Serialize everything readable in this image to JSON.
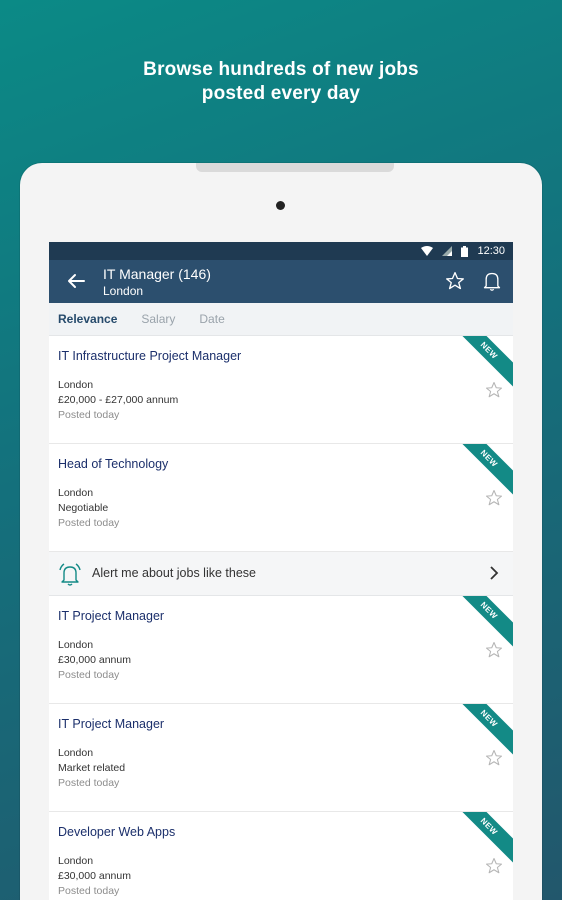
{
  "headline": {
    "line1": "Browse hundreds of new jobs",
    "line2": "posted every day"
  },
  "statusbar": {
    "time": "12:30",
    "icons": [
      "wifi-icon",
      "signal-icon",
      "battery-icon"
    ]
  },
  "appbar": {
    "title": "IT Manager (146)",
    "subtitle": "London",
    "icons": [
      "back-arrow-icon",
      "star-outline-icon",
      "bell-icon"
    ],
    "color": "#2c4f6e"
  },
  "sort": {
    "tabs": [
      {
        "label": "Relevance",
        "active": true
      },
      {
        "label": "Salary",
        "active": false
      },
      {
        "label": "Date",
        "active": false
      }
    ]
  },
  "jobs": [
    {
      "title": "IT Infrastructure Project Manager",
      "location": "London",
      "salary": "£20,000 - £27,000 annum",
      "posted": "Posted today",
      "badge": "NEW"
    },
    {
      "title": "Head of Technology",
      "location": "London",
      "salary": "Negotiable",
      "posted": "Posted today",
      "badge": "NEW"
    },
    {
      "title": " IT Project Manager",
      "location": "London",
      "salary": "£30,000 annum",
      "posted": "Posted today",
      "badge": "NEW"
    },
    {
      "title": "IT Project Manager",
      "location": "London",
      "salary": "Market related",
      "posted": "Posted today",
      "badge": "NEW"
    },
    {
      "title": "Developer Web Apps",
      "location": "London",
      "salary": "£30,000 annum",
      "posted": "Posted today",
      "badge": "NEW"
    }
  ],
  "alert": {
    "text": "Alert me about jobs like these",
    "icon": "ringing-bell-icon"
  },
  "colors": {
    "accent": "#138a86",
    "job_title": "#1b2f6b"
  }
}
